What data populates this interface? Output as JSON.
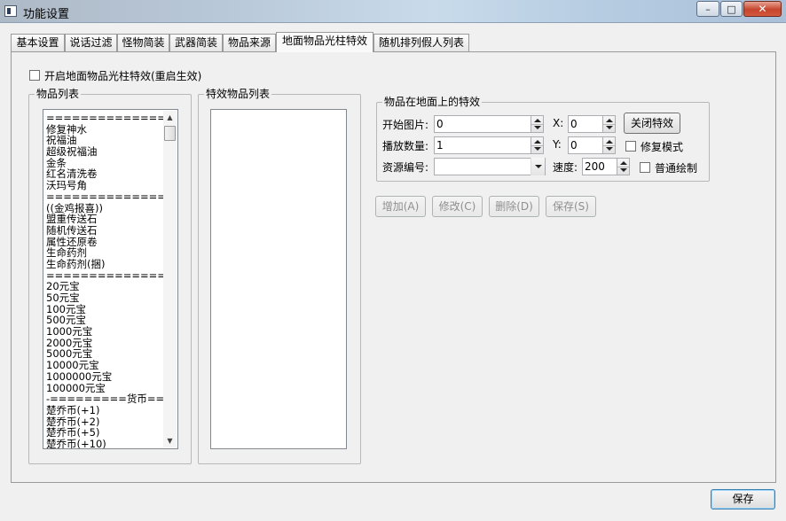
{
  "window": {
    "title": "功能设置",
    "minimize_glyph": "–",
    "maximize_glyph": "□",
    "close_glyph": "✕"
  },
  "tabs": [
    {
      "label": "基本设置",
      "active": false
    },
    {
      "label": "说话过滤",
      "active": false
    },
    {
      "label": "怪物简装",
      "active": false
    },
    {
      "label": "武器简装",
      "active": false
    },
    {
      "label": "物品来源",
      "active": false
    },
    {
      "label": "地面物品光柱特效",
      "active": true
    },
    {
      "label": "随机排列假人列表",
      "active": false
    }
  ],
  "enable_checkbox": {
    "label": "开启地面物品光柱特效(重启生效)",
    "checked": false
  },
  "item_list": {
    "title": "物品列表",
    "items": [
      "==================",
      "修复神水",
      "祝福油",
      "超级祝福油",
      "金条",
      "红名清洗卷",
      "沃玛号角",
      "===============传",
      "((金鸡报喜))",
      "盟重传送石",
      "随机传送石",
      "属性还原卷",
      "生命药剂",
      "生命药剂(捆)",
      "==================",
      "20元宝",
      "50元宝",
      "100元宝",
      "500元宝",
      "1000元宝",
      "2000元宝",
      "5000元宝",
      "10000元宝",
      "1000000元宝",
      "100000元宝",
      "-=========货币===",
      "楚乔币(+1)",
      "楚乔币(+2)",
      "楚乔币(+5)",
      "楚乔币(+10)"
    ]
  },
  "effect_list": {
    "title": "特效物品列表",
    "items": []
  },
  "effect_group": {
    "title": "物品在地面上的特效",
    "start_image_label": "开始图片:",
    "start_image_value": "0",
    "play_count_label": "播放数量:",
    "play_count_value": "1",
    "resource_label": "资源编号:",
    "resource_value": "",
    "x_label": "X:",
    "x_value": "0",
    "y_label": "Y:",
    "y_value": "0",
    "speed_label": "速度:",
    "speed_value": "200",
    "close_effect_label": "关闭特效",
    "repair_mode_label": "修复模式",
    "normal_draw_label": "普通绘制"
  },
  "actions": {
    "add_label": "增加(A)",
    "modify_label": "修改(C)",
    "delete_label": "删除(D)",
    "save_label": "保存(S)"
  },
  "footer": {
    "save_label": "保存"
  }
}
